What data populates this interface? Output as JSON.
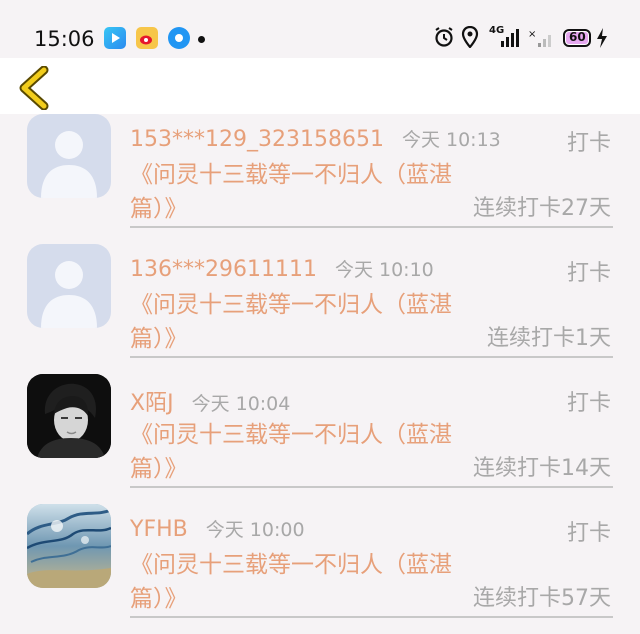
{
  "status_bar": {
    "time": "15:06",
    "network_label": "4G",
    "battery": "60"
  },
  "colors": {
    "accent": "#e7a07a",
    "muted_text": "#a8a8a8",
    "back_arrow": "#e8c200",
    "background": "#f6f3f5"
  },
  "entries": [
    {
      "username": "153***129_323158651",
      "time": "今天 10:13",
      "action": "打卡",
      "book": "《问灵十三载等一不归人（蓝湛篇）》",
      "streak": "连续打卡27天",
      "avatar": "default-avatar"
    },
    {
      "username": "136***29611111",
      "time": "今天 10:10",
      "action": "打卡",
      "book": "《问灵十三载等一不归人（蓝湛篇）》",
      "streak": "连续打卡1天",
      "avatar": "default-avatar"
    },
    {
      "username": "X陌J",
      "time": "今天 10:04",
      "action": "打卡",
      "book": "《问灵十三载等一不归人（蓝湛篇）》",
      "streak": "连续打卡14天",
      "avatar": "photo-portrait"
    },
    {
      "username": "YFHB",
      "time": "今天 10:00",
      "action": "打卡",
      "book": "《问灵十三载等一不归人（蓝湛篇）》",
      "streak": "连续打卡57天",
      "avatar": "illustrated-sky"
    }
  ]
}
